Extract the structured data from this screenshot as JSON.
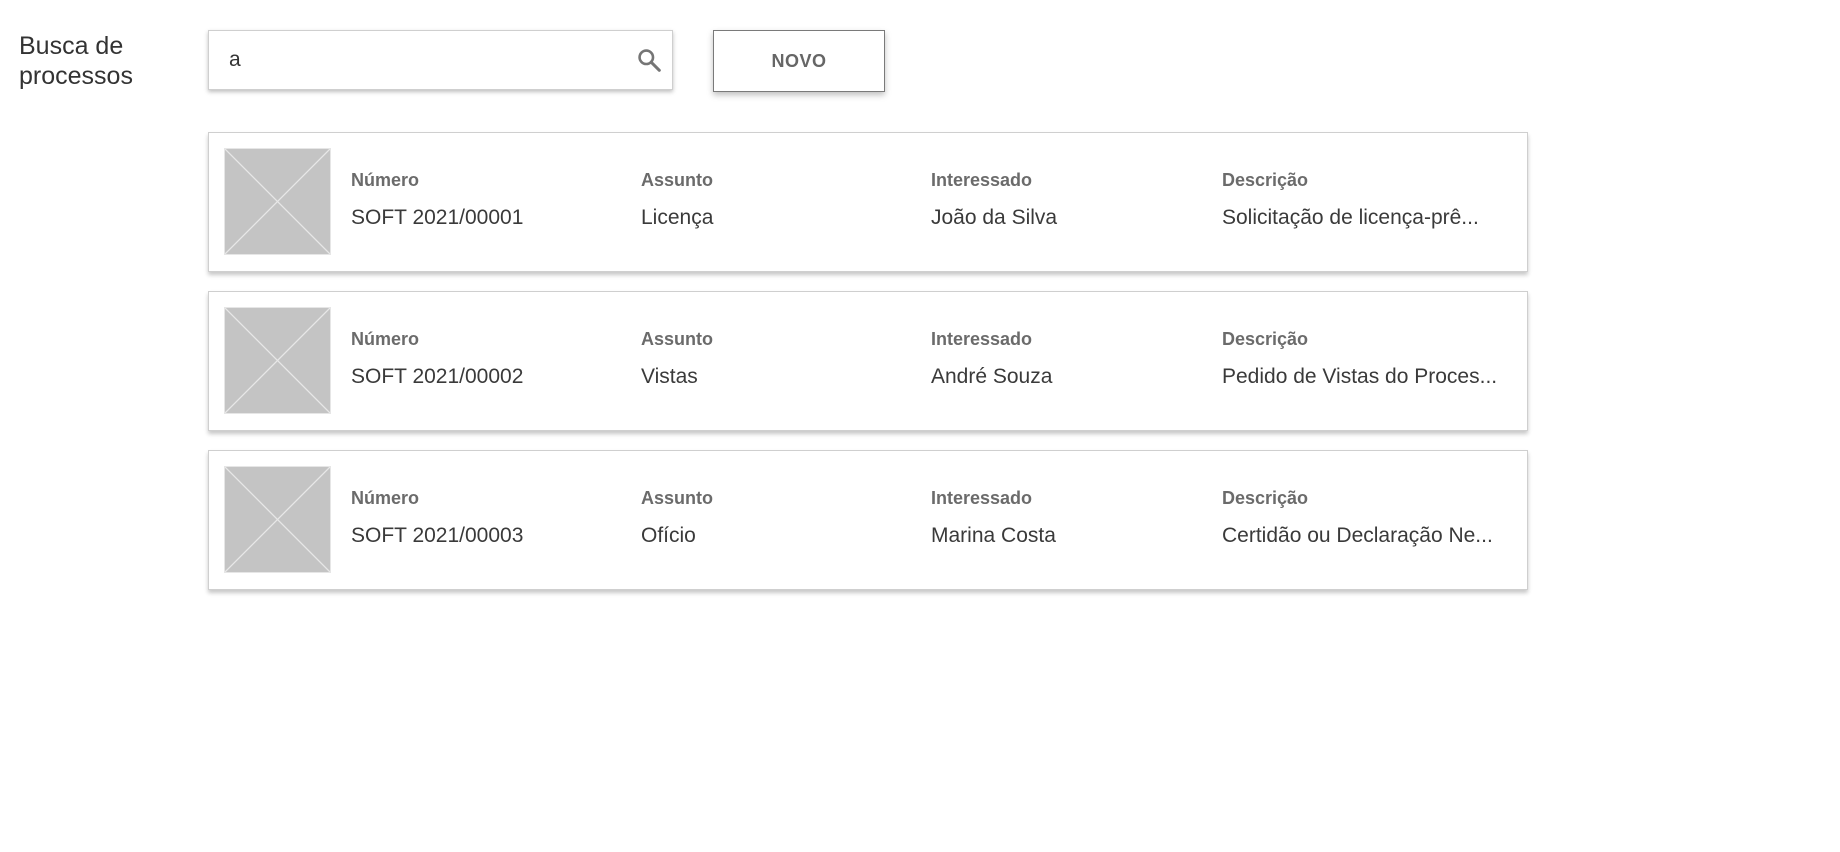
{
  "header": {
    "title": "Busca de processos",
    "search_value": "a",
    "new_button_label": "NOVO"
  },
  "icons": {
    "search": "search-icon",
    "thumbnail": "image-placeholder-icon"
  },
  "labels": {
    "numero": "Número",
    "assunto": "Assunto",
    "interessado": "Interessado",
    "descricao": "Descrição"
  },
  "processes": [
    {
      "numero": "SOFT 2021/00001",
      "assunto": "Licença",
      "interessado": "João da Silva",
      "descricao": "Solicitação de licença-prê..."
    },
    {
      "numero": "SOFT 2021/00002",
      "assunto": "Vistas",
      "interessado": "André Souza",
      "descricao": "Pedido de Vistas do Proces..."
    },
    {
      "numero": "SOFT 2021/00003",
      "assunto": "Ofício",
      "interessado": "Marina Costa",
      "descricao": "Certidão ou Declaração Ne..."
    }
  ],
  "colors": {
    "thumbnail_bg": "#c4c4c4",
    "label": "#6b6b6b",
    "value": "#3a3a3a",
    "border": "#cfcfcf"
  }
}
